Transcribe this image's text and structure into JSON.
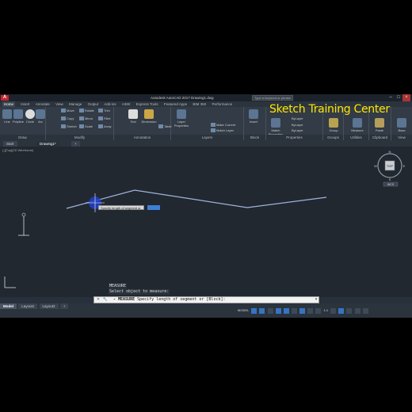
{
  "app": {
    "title": "Autodesk AutoCAD 2017   Drawing1.dwg",
    "logo": "A",
    "search_placeholder": "Type a keyword or phrase",
    "watermark": "Sketch Training Center",
    "accent": "#3674c2",
    "watermark_color": "#ffe600"
  },
  "menubar": [
    "Home",
    "Insert",
    "Annotate",
    "View",
    "Manage",
    "Output",
    "Add-ins",
    "A360",
    "Express Tools",
    "Featured Apps",
    "BIM 360",
    "Performance"
  ],
  "ribbon": {
    "groups": [
      {
        "title": "Draw",
        "big_tools": [
          "Line",
          "Polyline",
          "Circle",
          "Arc"
        ]
      },
      {
        "title": "Modify",
        "tools": [
          "Move",
          "Rotate",
          "Trim",
          "Copy",
          "Mirror",
          "Fillet",
          "Stretch",
          "Scale",
          "Array"
        ]
      },
      {
        "title": "Annotation",
        "big_tools": [
          "Text",
          "Dimension"
        ],
        "tools": [
          "Table"
        ]
      },
      {
        "title": "Layers",
        "big_tools": [
          "Layer Properties"
        ],
        "tools": [
          "Make Current",
          "Match Layer"
        ]
      },
      {
        "title": "Block",
        "big_tools": [
          "Insert"
        ]
      },
      {
        "title": "Properties",
        "big_tools": [
          "Match Properties"
        ],
        "tools": [
          "ByLayer",
          "ByLayer",
          "ByLayer"
        ]
      },
      {
        "title": "Groups",
        "big_tools": [
          "Group"
        ]
      },
      {
        "title": "Utilities",
        "big_tools": [
          "Measure"
        ]
      },
      {
        "title": "Clipboard",
        "big_tools": [
          "Paste"
        ]
      },
      {
        "title": "View",
        "big_tools": [
          "Base"
        ]
      }
    ]
  },
  "file_tabs": [
    {
      "label": "Start",
      "active": false
    },
    {
      "label": "Drawing1*",
      "active": true
    },
    {
      "label": "+",
      "active": false
    }
  ],
  "viewport": {
    "label": "[-][Top][2D Wireframe]",
    "tooltip": "Specify length of segment or",
    "tooltip_input": "",
    "viewcube": {
      "top": "TOP",
      "n": "N",
      "s": "S",
      "e": "E",
      "w": "W",
      "wcs": "WCS"
    }
  },
  "command": {
    "history": [
      "MEASURE",
      "Select object to measure:"
    ],
    "prompt_prefix": "- MEASURE",
    "prompt": "Specify length of segment or [Block]:"
  },
  "status": {
    "layout_tabs": [
      {
        "label": "Model",
        "active": true
      },
      {
        "label": "Layout1",
        "active": false
      },
      {
        "label": "Layout2",
        "active": false
      }
    ],
    "mode": "MODEL",
    "scale": "1:1"
  }
}
